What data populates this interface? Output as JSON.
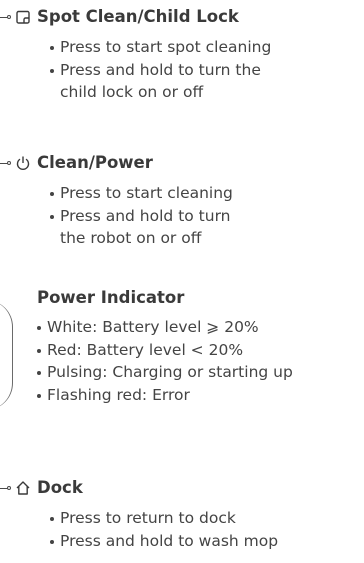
{
  "sections": [
    {
      "icon": "spot-clean-icon",
      "title": "Spot Clean/Child Lock",
      "items": [
        [
          "Press to start spot cleaning"
        ],
        [
          "Press and hold to turn the",
          "child lock on or off"
        ]
      ]
    },
    {
      "icon": "power-icon",
      "title": "Clean/Power",
      "items": [
        [
          "Press to start cleaning"
        ],
        [
          "Press and hold to turn",
          "the robot on or off"
        ]
      ]
    },
    {
      "icon": "",
      "title": "Power Indicator",
      "items": [
        [
          "White: Battery level ⩾ 20%"
        ],
        [
          "Red: Battery level < 20%"
        ],
        [
          "Pulsing: Charging or starting up"
        ],
        [
          "Flashing red: Error"
        ]
      ]
    },
    {
      "icon": "home-icon",
      "title": "Dock",
      "items": [
        [
          "Press to return to dock"
        ],
        [
          "Press and hold to wash mop"
        ]
      ]
    }
  ]
}
